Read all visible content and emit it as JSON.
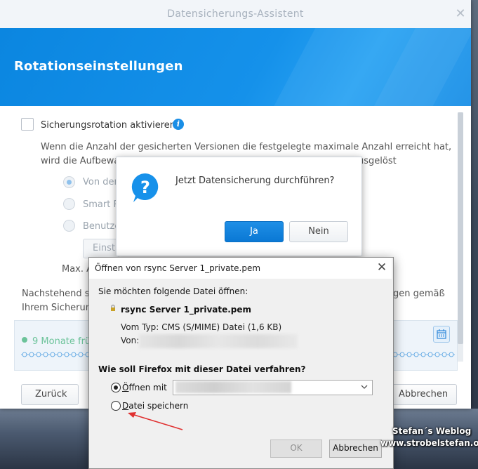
{
  "wizard": {
    "title": "Datensicherungs-Assistent",
    "close_glyph": "✕",
    "heading": "Rotationseinstellungen",
    "rotation_label": "Sicherungsrotation aktivieren",
    "info_glyph": "i",
    "description_line1": "Wenn die Anzahl der gesicherten Versionen die festgelegte maximale Anzahl erreicht hat,",
    "description_line2_start": "wird die Aufbewa",
    "description_line2_end": "usgelöst",
    "options": [
      {
        "label": "Von der",
        "selected": true
      },
      {
        "label": "Smart R",
        "selected": false
      },
      {
        "label": "Benutze",
        "selected": false
      }
    ],
    "settings_button_label": "Einst",
    "max_label": "Max. A",
    "below_line1_start": "Nachstehend se",
    "below_line1_end": "gen gemäß",
    "below_line2": "Ihrem Sicherun",
    "timeline_label": "9 Monate frü",
    "back_button": "Zurück",
    "cancel_button": "Abbrechen"
  },
  "confirm_dialog": {
    "message": "Jetzt Datensicherung durchführen?",
    "yes_button": "Ja",
    "no_button": "Nein"
  },
  "firefox_dialog": {
    "title": "Öffnen von rsync Server 1_private.pem",
    "close_glyph": "✕",
    "intro": "Sie möchten folgende Datei öffnen:",
    "file_name": "rsync Server 1_private.pem",
    "type_label": "Vom Typ:",
    "type_value": "CMS (S/MIME) Datei (1,6 KB)",
    "from_label": "Von:",
    "question": "Wie soll Firefox mit dieser Datei verfahren?",
    "open_with_access_key": "Ö",
    "open_with_rest": "ffnen mit",
    "save_file_access_key": "D",
    "save_file_rest": "atei speichern",
    "open_with_selected": true,
    "ok_button": "OK",
    "cancel_button": "Abbrechen"
  },
  "watermark": {
    "line1": "Stefan´s Weblog",
    "line2": "www.strobelstefan.org"
  },
  "colors": {
    "accent_blue": "#1591ea",
    "primary_button": "#0a78d4",
    "annotation_arrow": "#e03030",
    "timeline_green": "#6cc39a"
  }
}
